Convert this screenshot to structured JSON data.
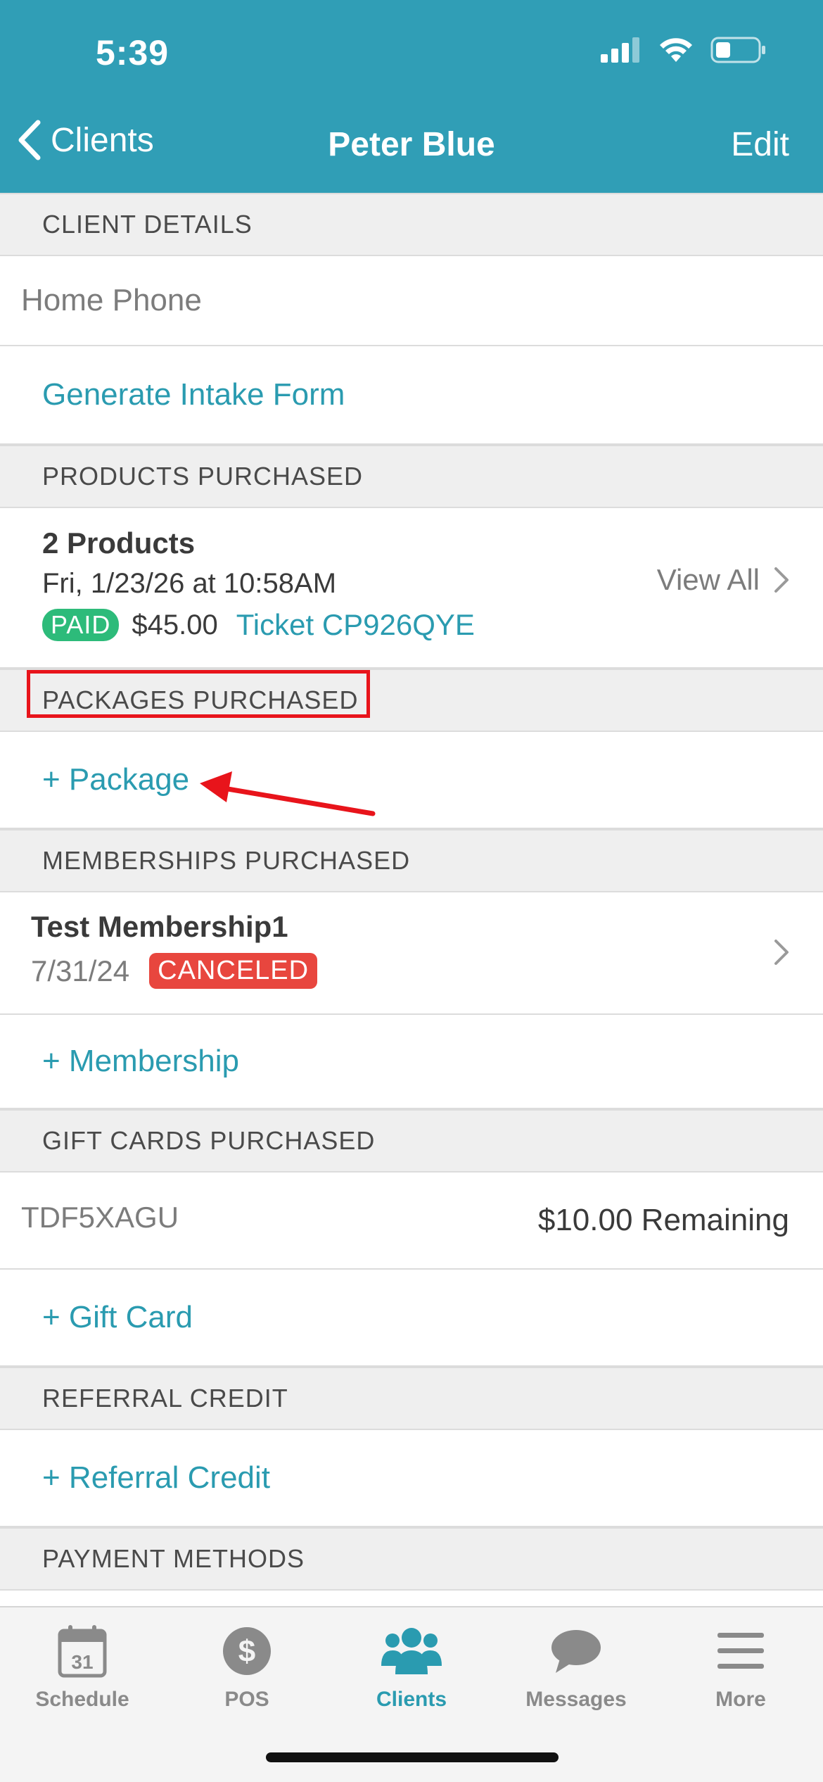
{
  "status_bar": {
    "time": "5:39"
  },
  "nav": {
    "back_label": "Clients",
    "title": "Peter Blue",
    "edit_label": "Edit"
  },
  "client_details": {
    "header": "CLIENT DETAILS",
    "home_phone_label": "Home Phone",
    "intake_form_link": "Generate Intake Form"
  },
  "products": {
    "header": "PRODUCTS PURCHASED",
    "title": "2 Products",
    "date": "Fri, 1/23/26 at 10:58AM",
    "status": "PAID",
    "amount": "$45.00",
    "ticket": "Ticket CP926QYE",
    "view_all": "View All"
  },
  "packages": {
    "header": "PACKAGES PURCHASED",
    "add_label": "+ Package"
  },
  "memberships": {
    "header": "MEMBERSHIPS PURCHASED",
    "item_name": "Test Membership1",
    "item_date": "7/31/24",
    "item_status": "CANCELED",
    "add_label": "+ Membership"
  },
  "gift_cards": {
    "header": "GIFT CARDS PURCHASED",
    "code": "TDF5XAGU",
    "remaining": "$10.00 Remaining",
    "add_label": "+ Gift Card"
  },
  "referral": {
    "header": "REFERRAL CREDIT",
    "add_label": "+ Referral Credit"
  },
  "payment_methods": {
    "header": "PAYMENT METHODS"
  },
  "tabs": [
    {
      "label": "Schedule",
      "icon": "calendar-icon",
      "calendar_day": "31"
    },
    {
      "label": "POS",
      "icon": "dollar-icon"
    },
    {
      "label": "Clients",
      "icon": "people-icon",
      "active": true
    },
    {
      "label": "Messages",
      "icon": "chat-bubble-icon"
    },
    {
      "label": "More",
      "icon": "menu-icon"
    }
  ],
  "colors": {
    "brand": "#309eb6",
    "link": "#2a9bb0",
    "paid_badge": "#2dbb7a",
    "canceled_badge": "#e8463e",
    "annotation": "#e8141b"
  }
}
